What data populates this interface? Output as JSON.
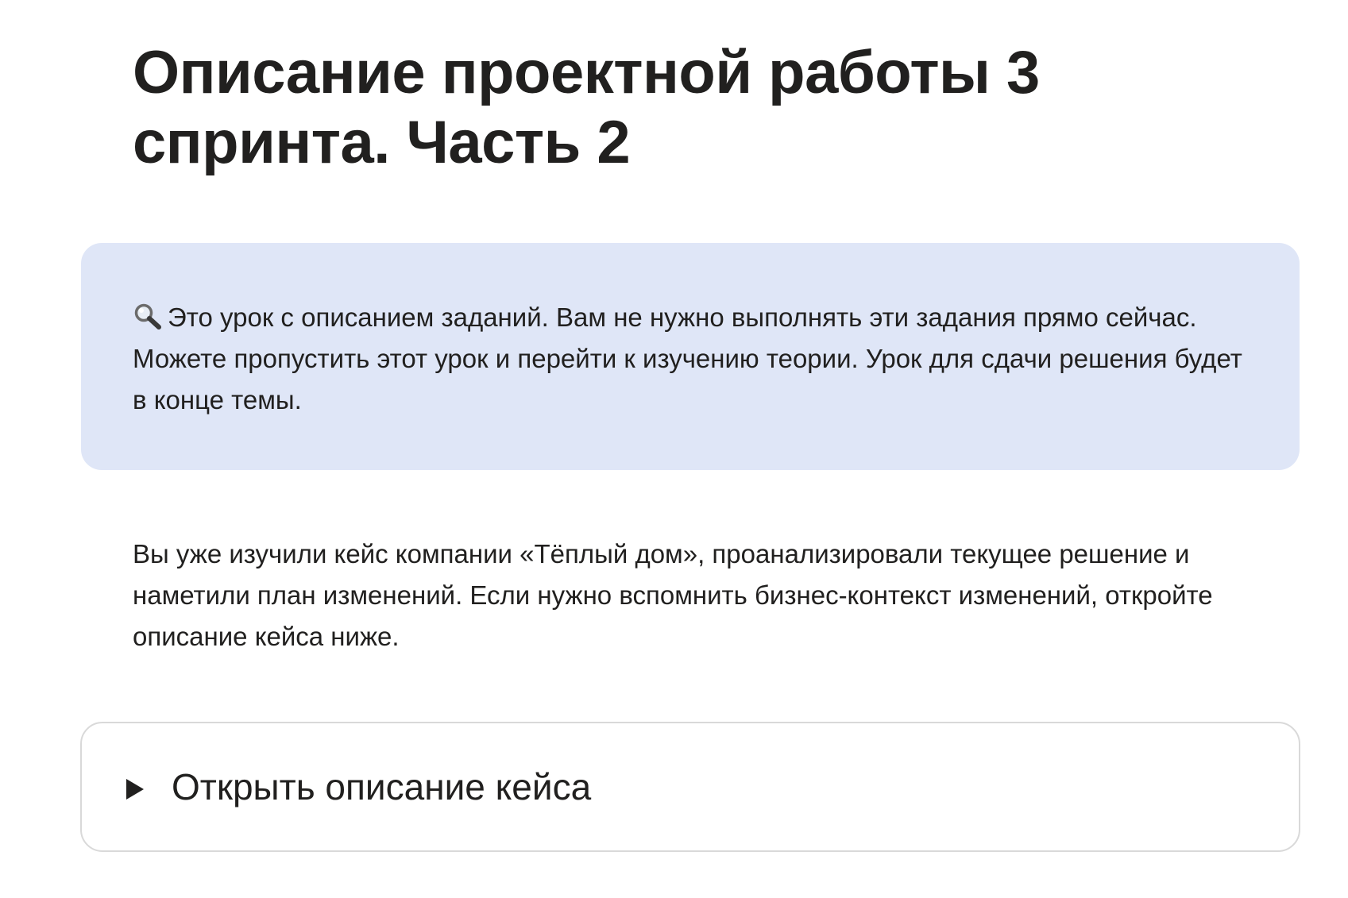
{
  "page": {
    "title": "Описание проектной работы 3 спринта. Часть 2"
  },
  "callout": {
    "icon": "magnifying-glass-icon",
    "text": "Это урок с описанием заданий. Вам не нужно выполнять эти задания прямо сейчас. Можете пропустить этот урок и перейти к изучению теории. Урок для сдачи решения будет в конце темы.",
    "background_color": "#dfe6f7"
  },
  "intro": {
    "text": "Вы уже изучили кейс компании «Тёплый дом», проанализировали текущее решение и наметили план изменений. Если нужно вспомнить бизнес-контекст изменений, откройте описание кейса ниже."
  },
  "details": {
    "summary_label": "Открыть описание кейса",
    "expanded": false
  }
}
